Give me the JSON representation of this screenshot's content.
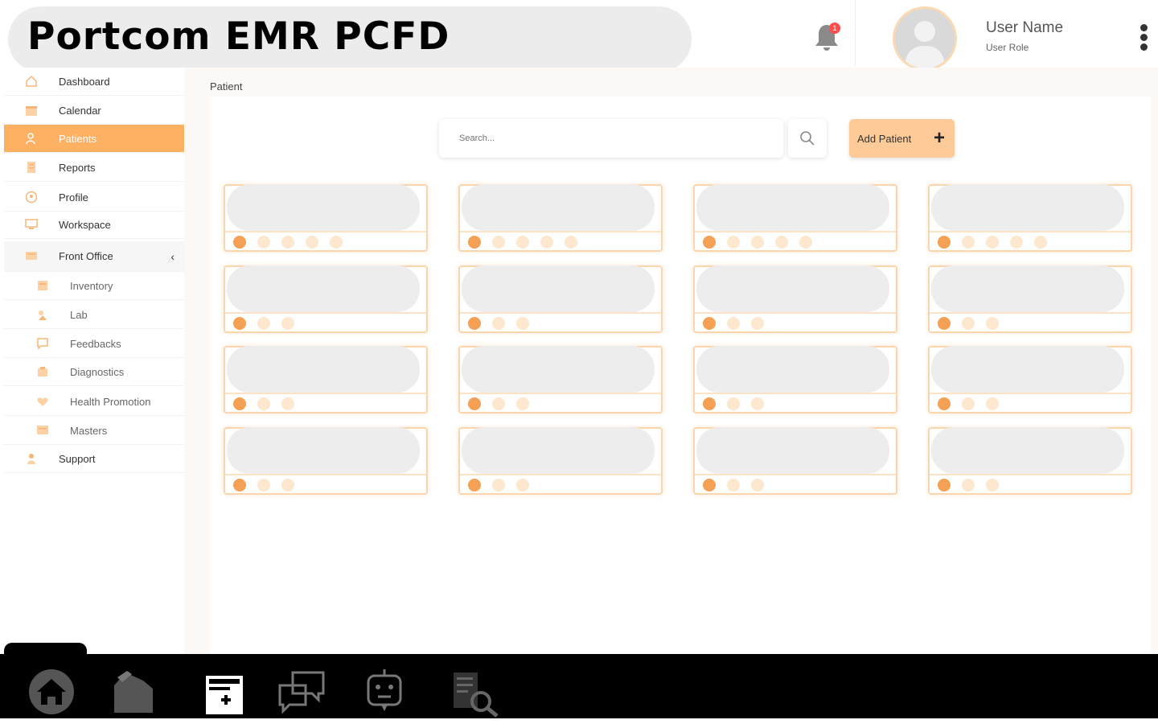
{
  "app": {
    "title": "Portcom EMR PCFD"
  },
  "header": {
    "notification_count": "1",
    "user_name": "User Name",
    "user_role": "User Role"
  },
  "sidebar": {
    "items": [
      {
        "label": "Dashboard",
        "icon": "home-icon"
      },
      {
        "label": "Calendar",
        "icon": "calendar-icon"
      },
      {
        "label": "Patients",
        "icon": "patients-icon",
        "active": true
      },
      {
        "label": "Reports",
        "icon": "reports-icon"
      },
      {
        "label": "Profile",
        "icon": "profile-icon"
      },
      {
        "label": "Workspace",
        "icon": "workspace-icon"
      },
      {
        "label": "Front Office",
        "icon": "front-office-icon",
        "expanded": true
      },
      {
        "label": "Inventory",
        "icon": "inventory-icon"
      },
      {
        "label": "Lab",
        "icon": "lab-icon"
      },
      {
        "label": "Feedbacks",
        "icon": "feedback-icon"
      },
      {
        "label": "Diagnostics",
        "icon": "diagnostics-icon"
      },
      {
        "label": "Health Promotion",
        "icon": "health-promotion-icon"
      },
      {
        "label": "Masters",
        "icon": "masters-icon"
      },
      {
        "label": "Support",
        "icon": "support-icon"
      }
    ]
  },
  "main": {
    "breadcrumb": "Patient",
    "search": {
      "placeholder": "Search...",
      "value": ""
    },
    "add_button_label": "Add Patient"
  },
  "taskbar": {
    "icons": [
      "home-icon",
      "files-icon",
      "medical-record-icon",
      "chat-icon",
      "bot-icon",
      "document-search-icon"
    ]
  },
  "colors": {
    "accent": "#ffb163",
    "accent_light": "#fecb98",
    "card_border": "#fbd6ad",
    "badge": "#ff4d4f"
  }
}
